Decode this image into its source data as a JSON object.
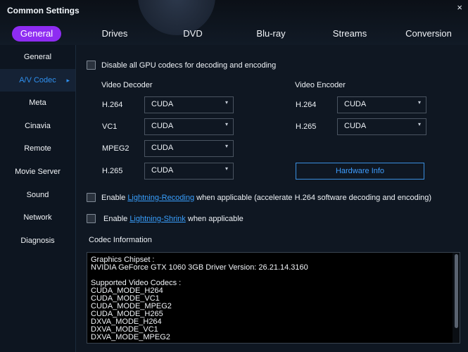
{
  "window": {
    "title": "Common Settings",
    "close_label": "×"
  },
  "tabs": [
    {
      "label": "General",
      "active": true
    },
    {
      "label": "Drives"
    },
    {
      "label": "DVD"
    },
    {
      "label": "Blu-ray"
    },
    {
      "label": "Streams"
    },
    {
      "label": "Conversion"
    }
  ],
  "sidebar": {
    "items": [
      {
        "label": "General"
      },
      {
        "label": "A/V Codec",
        "active": true
      },
      {
        "label": "Meta"
      },
      {
        "label": "Cinavia"
      },
      {
        "label": "Remote"
      },
      {
        "label": "Movie Server"
      },
      {
        "label": "Sound"
      },
      {
        "label": "Network"
      },
      {
        "label": "Diagnosis"
      }
    ],
    "active_arrow": "▸"
  },
  "main": {
    "disable_gpu_label": "Disable all GPU codecs for decoding and encoding",
    "decoder": {
      "heading": "Video Decoder",
      "rows": [
        {
          "label": "H.264",
          "value": "CUDA"
        },
        {
          "label": "VC1",
          "value": "CUDA"
        },
        {
          "label": "MPEG2",
          "value": "CUDA"
        },
        {
          "label": "H.265",
          "value": "CUDA"
        }
      ]
    },
    "encoder": {
      "heading": "Video Encoder",
      "rows": [
        {
          "label": "H.264",
          "value": "CUDA"
        },
        {
          "label": "H.265",
          "value": "CUDA"
        }
      ]
    },
    "hardware_info_label": "Hardware Info",
    "lightning_recoding": {
      "prefix": "Enable ",
      "link": "Lightning-Recoding",
      "suffix": " when applicable (accelerate H.264 software decoding and encoding)"
    },
    "lightning_shrink": {
      "prefix": "Enable ",
      "link": "Lightning-Shrink",
      "suffix": " when applicable"
    },
    "codec_info_heading": "Codec Information",
    "codec_info_lines": [
      "Graphics Chipset :",
      "NVIDIA GeForce GTX 1060 3GB Driver Version: 26.21.14.3160",
      "",
      "Supported Video Codecs :",
      "CUDA_MODE_H264",
      "CUDA_MODE_VC1",
      "CUDA_MODE_MPEG2",
      "CUDA_MODE_H265",
      "DXVA_MODE_H264",
      "DXVA_MODE_VC1",
      "DXVA_MODE_MPEG2"
    ]
  },
  "icons": {
    "caret": "▾"
  },
  "colors": {
    "accent": "#8e2cf2",
    "link": "#39a0ff",
    "active_side": "#2f90ef"
  }
}
